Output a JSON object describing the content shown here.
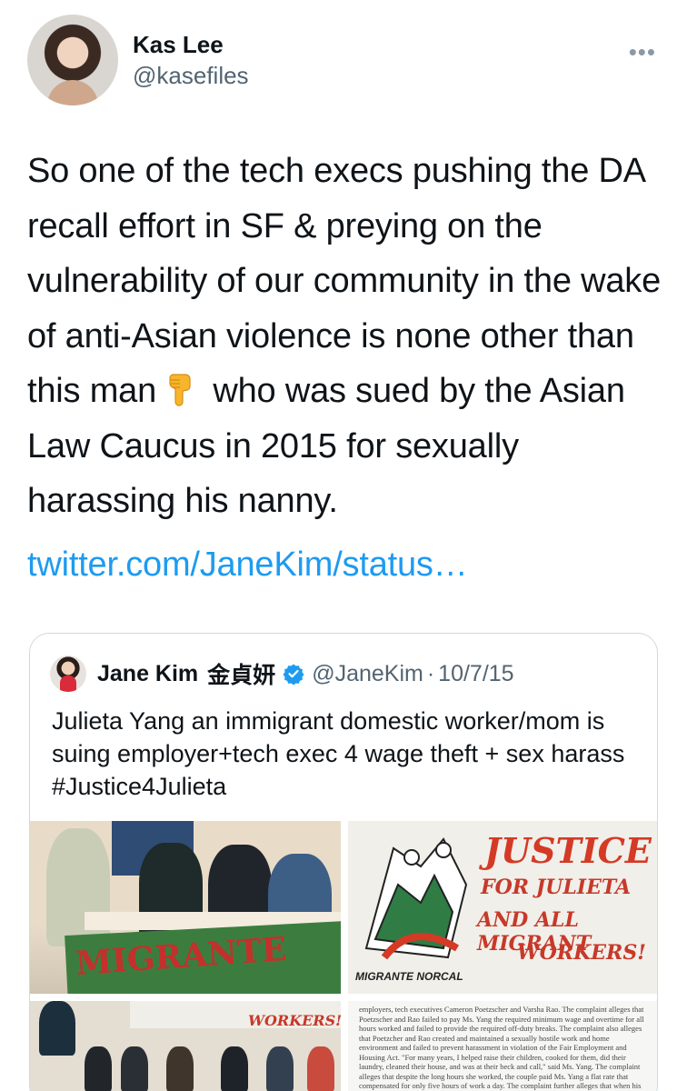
{
  "author": {
    "name": "Kas Lee",
    "handle": "@kasefiles",
    "more_icon": "more-icon"
  },
  "tweet": {
    "text_before_emoji": "So one of the tech execs pushing the DA recall effort in SF & preying on the vulnerability of our community in the wake of anti-Asian violence is none other than this man",
    "emoji": "backhand-index-pointing-down",
    "text_after_emoji": " who was sued by the Asian Law Caucus in 2015 for sexually harassing his nanny.",
    "link": "twitter.com/JaneKim/status…"
  },
  "quoted": {
    "name": "Jane Kim",
    "name_cjk": "金貞妍",
    "verified": true,
    "handle": "@JaneKim",
    "separator": "·",
    "date": "10/7/15",
    "text": "Julieta Yang an immigrant domestic worker/mom is suing employer+tech exec 4 wage theft + sex harass #Justice4Julieta",
    "media": {
      "poster_line1": "JUSTICE",
      "poster_line2": "FOR JULIETA",
      "poster_line3": "AND ALL MIGRANT",
      "poster_line4": "WORKERS!",
      "poster_org": "MIGRANTE NORCAL",
      "banner_text": "MIGRANTE",
      "workers_text": "WORKERS!",
      "doc_text": "employers, tech executives Cameron Poetzscher and Varsha Rao. The complaint alleges that Poetzscher and Rao failed to pay Ms. Yang the required minimum wage and overtime for all hours worked and failed to provide the required off-duty breaks. The complaint also alleges that Poetzcher and Rao created and maintained a sexually hostile work and home environment and failed to prevent harassment in violation of the Fair Employment and Housing Act. \"For many years, I helped raise their children, cooked for them, did their laundry, cleaned their house, and was at their beck and call,\" said Ms. Yang. The complaint alleges that despite the long hours she worked, the couple paid Ms. Yang a flat rate that compensated for only five hours of work a day. The complaint further alleges that when his wife and kids were not home, Poetzscher sexually harassed Ms. Yang including but not limited to nudity, comments of a sexual nature, unwanted sexual"
    }
  },
  "colors": {
    "link": "#1d9bf0",
    "text": "#0f1419",
    "secondary": "#536471",
    "verified": "#1d9bf0"
  }
}
